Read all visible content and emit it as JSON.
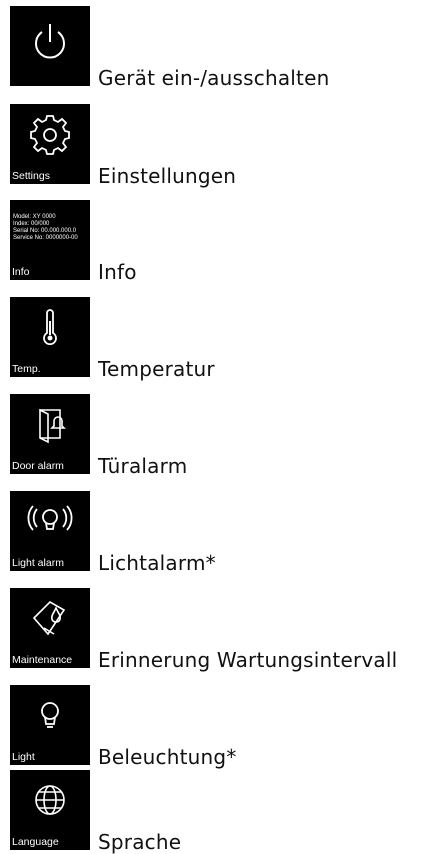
{
  "items": [
    {
      "icon": "power-icon",
      "caption": "",
      "label": "Gerät ein-/ausschalten"
    },
    {
      "icon": "gear-icon",
      "caption": "Settings",
      "label": "Einstellungen"
    },
    {
      "icon": "info-icon",
      "caption": "Info",
      "label": "Info",
      "info_lines": [
        "Model: XY 0000",
        "Index: 00/000",
        "Serial No: 00.000.000.0",
        "Service No: 0000000-00"
      ]
    },
    {
      "icon": "thermometer-icon",
      "caption": "Temp.",
      "label": "Temperatur"
    },
    {
      "icon": "door-alarm-icon",
      "caption": "Door alarm",
      "label": "Türalarm"
    },
    {
      "icon": "light-alarm-icon",
      "caption": "Light alarm",
      "label": "Lichtalarm*"
    },
    {
      "icon": "maintenance-icon",
      "caption": "Maintenance",
      "label": "Erinnerung Wartungsintervall"
    },
    {
      "icon": "light-bulb-icon",
      "caption": "Light",
      "label": "Beleuchtung*"
    },
    {
      "icon": "globe-icon",
      "caption": "Language",
      "label": "Sprache"
    }
  ]
}
